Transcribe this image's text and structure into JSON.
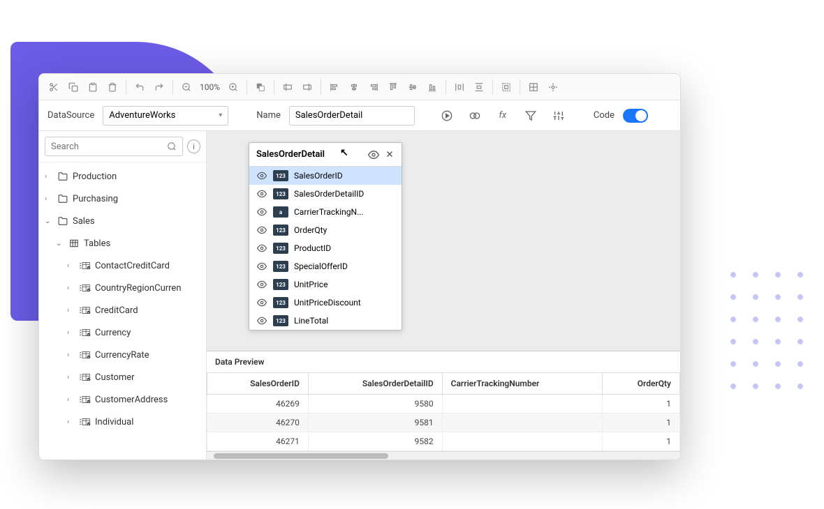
{
  "toolbar": {
    "zoom": "100%"
  },
  "config": {
    "datasource_label": "DataSource",
    "datasource_value": "AdventureWorks",
    "name_label": "Name",
    "name_value": "SalesOrderDetail",
    "code_label": "Code"
  },
  "search": {
    "placeholder": "Search"
  },
  "tree": {
    "items": [
      {
        "label": "Production",
        "type": "folder",
        "expanded": false,
        "depth": 0
      },
      {
        "label": "Purchasing",
        "type": "folder",
        "expanded": false,
        "depth": 0
      },
      {
        "label": "Sales",
        "type": "folder",
        "expanded": true,
        "depth": 0
      },
      {
        "label": "Tables",
        "type": "group",
        "expanded": true,
        "depth": 1
      },
      {
        "label": "ContactCreditCard",
        "type": "table",
        "depth": 2
      },
      {
        "label": "CountryRegionCurren",
        "type": "table",
        "depth": 2
      },
      {
        "label": "CreditCard",
        "type": "table",
        "depth": 2
      },
      {
        "label": "Currency",
        "type": "table",
        "depth": 2
      },
      {
        "label": "CurrencyRate",
        "type": "table",
        "depth": 2
      },
      {
        "label": "Customer",
        "type": "table",
        "depth": 2
      },
      {
        "label": "CustomerAddress",
        "type": "table",
        "depth": 2
      },
      {
        "label": "Individual",
        "type": "table",
        "depth": 2
      }
    ]
  },
  "entity": {
    "title": "SalesOrderDetail",
    "fields": [
      {
        "name": "SalesOrderID",
        "type": "123",
        "selected": true
      },
      {
        "name": "SalesOrderDetailID",
        "type": "123",
        "selected": false
      },
      {
        "name": "CarrierTrackingN...",
        "type": "a",
        "selected": false
      },
      {
        "name": "OrderQty",
        "type": "123",
        "selected": false
      },
      {
        "name": "ProductID",
        "type": "123",
        "selected": false
      },
      {
        "name": "SpecialOfferID",
        "type": "123",
        "selected": false
      },
      {
        "name": "UnitPrice",
        "type": "123",
        "selected": false
      },
      {
        "name": "UnitPriceDiscount",
        "type": "123",
        "selected": false
      },
      {
        "name": "LineTotal",
        "type": "123",
        "selected": false
      }
    ]
  },
  "preview": {
    "title": "Data Preview",
    "columns": [
      "SalesOrderID",
      "SalesOrderDetailID",
      "CarrierTrackingNumber",
      "OrderQty"
    ],
    "rows": [
      [
        "46269",
        "9580",
        "",
        "1"
      ],
      [
        "46270",
        "9581",
        "",
        "1"
      ],
      [
        "46271",
        "9582",
        "",
        "1"
      ]
    ]
  }
}
